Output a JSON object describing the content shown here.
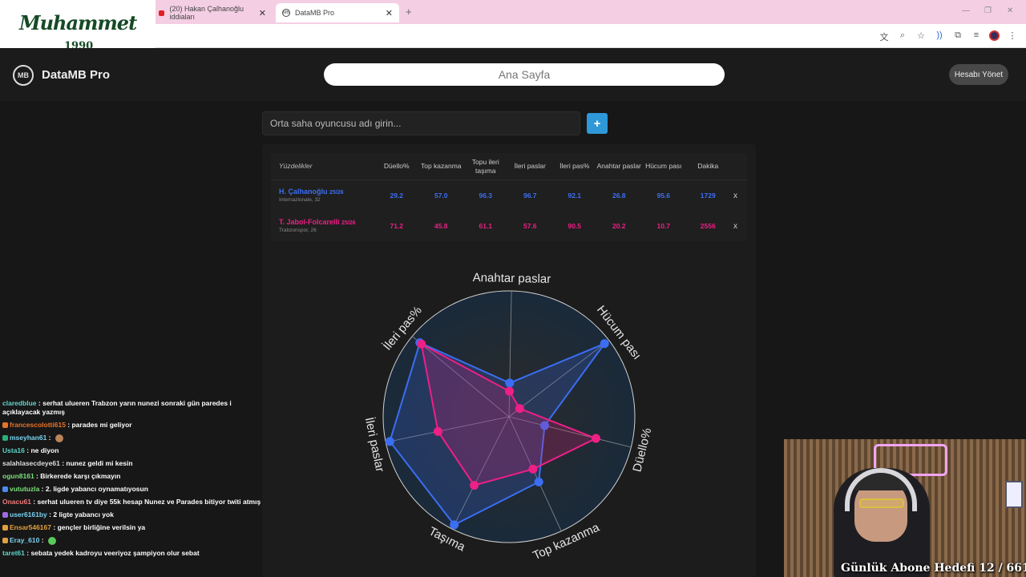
{
  "browser": {
    "tabs": [
      {
        "label": "(20) Hakan Çalhanoğlu iddiaları",
        "active": false,
        "icon": "youtube-icon"
      },
      {
        "label": "DataMB Pro",
        "active": true,
        "icon": "datamb-icon"
      }
    ],
    "close_glyph": "✕",
    "new_tab_glyph": "+"
  },
  "overlay_logo": {
    "line1": "Muhammet",
    "line2": "1990"
  },
  "site": {
    "logo_text": "MB",
    "brand": "DataMB Pro",
    "home_button": "Ana Sayfa",
    "account_button": "Hesabı Yönet"
  },
  "search": {
    "placeholder": "Orta saha oyuncusu adı girin...",
    "add_label": "+"
  },
  "table": {
    "header_first": "Yüzdelikler",
    "columns": [
      "Düello%",
      "Top kazanma",
      "Topu ileri taşıma",
      "İleri paslar",
      "İleri pas%",
      "Anahtar paslar",
      "Hücum pası",
      "Dakika"
    ],
    "players": [
      {
        "name": "H. Çalhanoğlu",
        "season": "25/26",
        "club": "Internazionale, 32",
        "color": "#3b6ef2",
        "values": [
          "29.2",
          "57.0",
          "96.3",
          "96.7",
          "92.1",
          "26.8",
          "95.6",
          "1729"
        ],
        "remove": "x"
      },
      {
        "name": "T. Jabol-Folcarelli",
        "season": "25/26",
        "club": "Trabzonspor, 26",
        "color": "#ee1f85",
        "values": [
          "71.2",
          "45.8",
          "61.1",
          "57.6",
          "90.5",
          "20.2",
          "10.7",
          "2556"
        ],
        "remove": "x"
      }
    ]
  },
  "chart_data": {
    "type": "radar",
    "axes": [
      "Anahtar paslar",
      "Hücum pası",
      "Düello%",
      "Top kazanma",
      "Taşıma",
      "İleri paslar",
      "İleri pas%"
    ],
    "range": [
      0,
      100
    ],
    "series": [
      {
        "name": "H. Çalhanoğlu",
        "color": "#3b6ef2",
        "values": [
          26.8,
          95.6,
          29.2,
          57.0,
          96.3,
          96.7,
          92.1
        ]
      },
      {
        "name": "T. Jabol-Folcarelli",
        "color": "#ee1f85",
        "values": [
          20.2,
          10.7,
          71.2,
          45.8,
          61.1,
          57.6,
          90.5
        ]
      }
    ]
  },
  "chat": [
    {
      "user": "claredblue",
      "color": "#5fd4c8",
      "text": "serhat ulueren Trabzon yarın nunezi sonraki gün paredes i açıklayacak yazmış",
      "badge": ""
    },
    {
      "user": "francescolotti615",
      "color": "#e8742a",
      "text": "parades mi geliyor",
      "badge": "#e8742a"
    },
    {
      "user": "mseyhan61",
      "color": "#7ad3f2",
      "text": "",
      "badge": "#2ab07a",
      "emote": "#b8845a"
    },
    {
      "user": "Usta16",
      "color": "#5fd4c8",
      "text": "ne diyon",
      "badge": ""
    },
    {
      "user": "salahlasecdeye61",
      "color": "#dddddd",
      "text": "nunez geldi mi kesin",
      "badge": ""
    },
    {
      "user": "ogun8161",
      "color": "#7be07b",
      "text": "Birkerede karşı çıkmayın",
      "badge": ""
    },
    {
      "user": "vututuzla",
      "color": "#7be07b",
      "text": "2. ligde yabancı oynamatıyosun",
      "badge": "#4a8cf0"
    },
    {
      "user": "Onacu61",
      "color": "#f27a7a",
      "text": "serhat ulueren tv diye 55k hesap Nunez ve Parades bitiyor twiti atmış",
      "badge": ""
    },
    {
      "user": "user6161by",
      "color": "#7ad3f2",
      "text": "2 ligte yabancı yok",
      "badge": "#a06ae0"
    },
    {
      "user": "Ensar546167",
      "color": "#e0a040",
      "text": "gençler birliğine verilsin ya",
      "badge": "#e0a040"
    },
    {
      "user": "Eray_610",
      "color": "#7ad3f2",
      "text": "",
      "badge": "#e0a040",
      "emote": "#5ac85a"
    },
    {
      "user": "taret61",
      "color": "#5fd4c8",
      "text": "sebata yedek kadroyu veeriyoz şampiyon olur sebat",
      "badge": ""
    }
  ],
  "stream_goal": "Günlük Abone Hedefi 12 / 661"
}
